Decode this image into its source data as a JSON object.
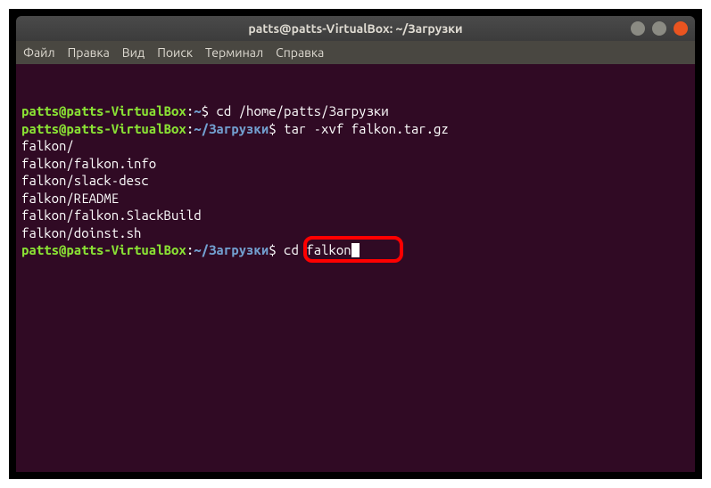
{
  "titlebar": {
    "title": "patts@patts-VirtualBox: ~/Загрузки"
  },
  "menubar": {
    "items": [
      "Файл",
      "Правка",
      "Вид",
      "Поиск",
      "Терминал",
      "Справка"
    ]
  },
  "terminal": {
    "lines": [
      {
        "prompt_user": "patts@patts-VirtualBox",
        "prompt_colon": ":",
        "prompt_path": "~",
        "prompt_dollar": "$ ",
        "command": "cd /home/patts/Загрузки"
      },
      {
        "prompt_user": "patts@patts-VirtualBox",
        "prompt_colon": ":",
        "prompt_path": "~/Загрузки",
        "prompt_dollar": "$ ",
        "command": "tar -xvf falkon.tar.gz"
      },
      {
        "output": "falkon/"
      },
      {
        "output": "falkon/falkon.info"
      },
      {
        "output": "falkon/slack-desc"
      },
      {
        "output": "falkon/README"
      },
      {
        "output": "falkon/falkon.SlackBuild"
      },
      {
        "output": "falkon/doinst.sh"
      },
      {
        "prompt_user": "patts@patts-VirtualBox",
        "prompt_colon": ":",
        "prompt_path": "~/Загрузки",
        "prompt_dollar": "$ ",
        "command": "cd falkon",
        "cursor": true,
        "highlight": true
      }
    ]
  }
}
